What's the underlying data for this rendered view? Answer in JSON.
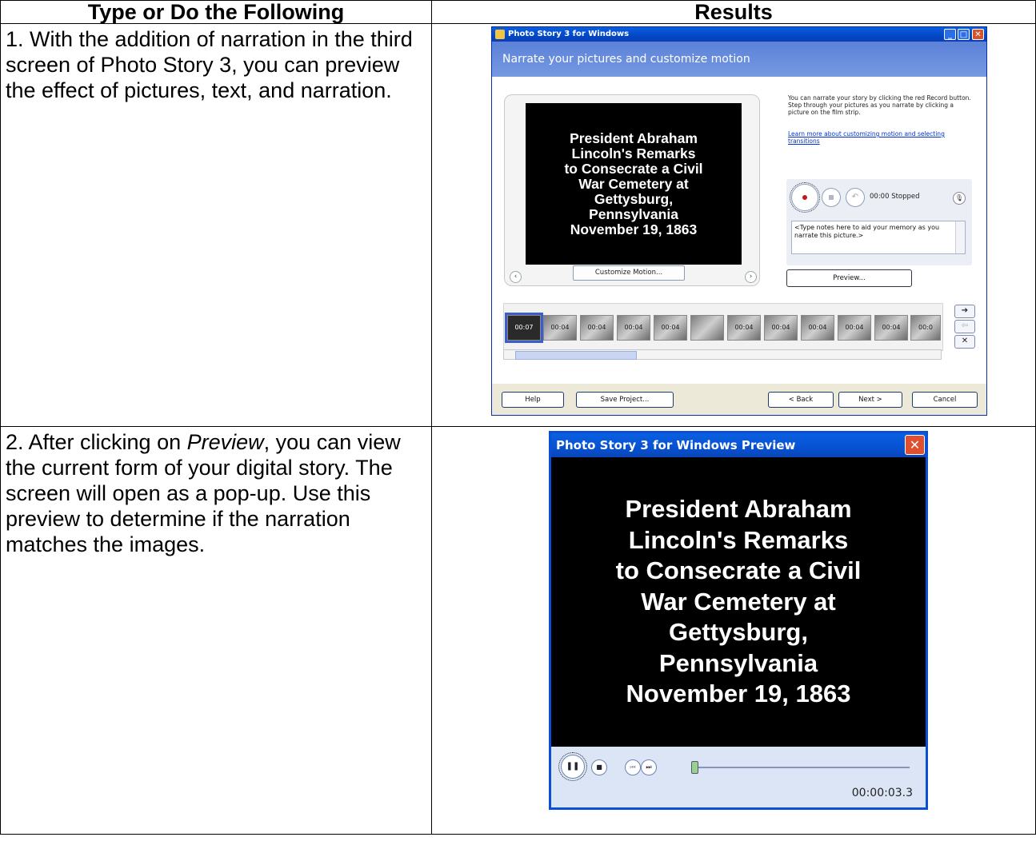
{
  "table": {
    "header_left": "Type or Do the Following",
    "header_right": "Results",
    "rows": [
      {
        "instruction": "1.  With the addition of narration in the third screen of Photo Story 3, you can preview the effect of pictures, text, and narration."
      },
      {
        "instruction_prefix": "2. After clicking on ",
        "instruction_italic": "Preview",
        "instruction_suffix": ", you can view the current form of your digital story. The screen will open as a pop-up. Use this preview to determine if the narration matches the images."
      }
    ]
  },
  "photostory": {
    "title": "Photo Story 3 for Windows",
    "header": "Narrate your pictures and customize motion",
    "slide_text": "President Abraham\nLincoln's Remarks\nto Consecrate a Civil\nWar Cemetery at\nGettysburg,\nPennsylvania\nNovember 19, 1863",
    "customize_motion": "Customize Motion...",
    "help_text": "You can narrate your story by clicking the red Record button. Step through your pictures as you narrate by clicking a picture on the film strip.",
    "help_link": "Learn more about customizing motion and selecting transitions",
    "recorder_status": "00:00  Stopped",
    "notes_placeholder": "<Type notes here to aid your memory as you narrate this picture.>",
    "preview_button": "Preview...",
    "thumbnails": [
      "00:07",
      "00:04",
      "00:04",
      "00:04",
      "00:04",
      "",
      "00:04",
      "00:04",
      "00:04",
      "00:04",
      "00:04",
      "00:0"
    ],
    "buttons": {
      "help": "Help",
      "save": "Save Project...",
      "back": "< Back",
      "next": "Next >",
      "cancel": "Cancel"
    }
  },
  "preview_window": {
    "title": "Photo Story 3 for Windows Preview",
    "slide_text": "President Abraham\nLincoln's Remarks\nto Consecrate a Civil\nWar Cemetery at\nGettysburg,\nPennsylvania\nNovember 19, 1863",
    "time": "00:00:03.3",
    "progress": 0.01
  }
}
